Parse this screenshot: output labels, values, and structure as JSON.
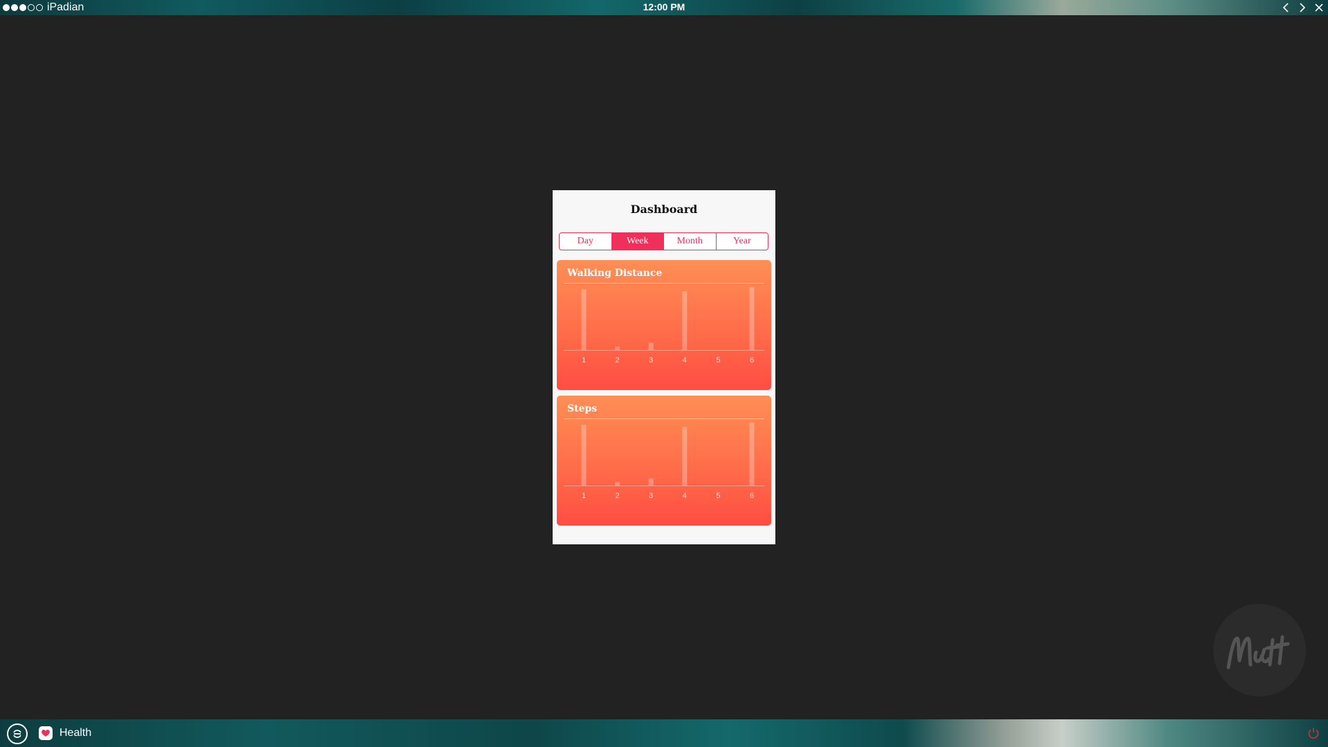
{
  "statusbar": {
    "carrier_name": "iPadian",
    "signal_filled": 3,
    "signal_total": 5,
    "time": "12:00 PM"
  },
  "window_controls": [
    "back-icon",
    "forward-icon",
    "close-icon"
  ],
  "app": {
    "title": "Dashboard",
    "segments": [
      {
        "label": "Day",
        "active": false
      },
      {
        "label": "Week",
        "active": true
      },
      {
        "label": "Month",
        "active": false
      },
      {
        "label": "Year",
        "active": false
      }
    ],
    "accent_color": "#f0305a"
  },
  "chart_data": [
    {
      "type": "bar",
      "title": "Walking Distance",
      "categories": [
        "1",
        "2",
        "3",
        "4",
        "5",
        "6"
      ],
      "values": [
        1.0,
        0.06,
        0.12,
        0.97,
        0,
        1.04
      ],
      "ylim": [
        0,
        1.05
      ],
      "grid": false
    },
    {
      "type": "bar",
      "title": "Steps",
      "categories": [
        "1",
        "2",
        "3",
        "4",
        "5",
        "6"
      ],
      "values": [
        1.0,
        0.06,
        0.12,
        0.97,
        0,
        1.04
      ],
      "ylim": [
        0,
        1.05
      ],
      "grid": false
    }
  ],
  "taskbar": {
    "start_icon": "ipadian-logo-icon",
    "app_label": "Health",
    "app_icon": "heart-icon",
    "power_icon": "power-icon"
  }
}
